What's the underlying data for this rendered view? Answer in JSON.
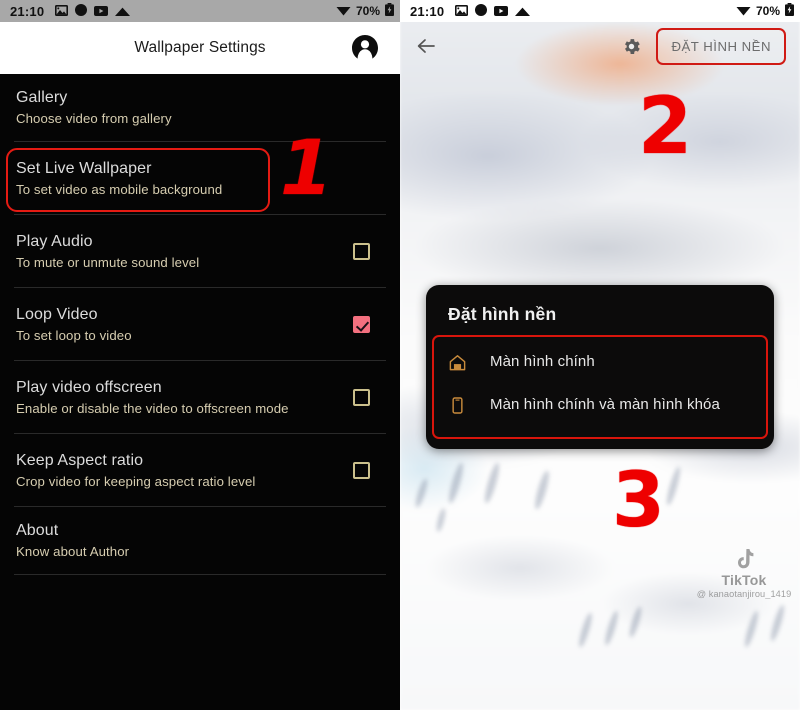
{
  "status_bar": {
    "time": "21:10",
    "battery_percent": "70%",
    "left_icons": [
      "image-icon",
      "record-circle-icon",
      "youtube-icon",
      "cloud-icon"
    ],
    "right_icons": [
      "wifi-icon",
      "battery-icon"
    ]
  },
  "left_screen": {
    "app_bar": {
      "title": "Wallpaper Settings",
      "avatar_icon": "account-avatar-icon"
    },
    "settings_rows": [
      {
        "title": "Gallery",
        "subtitle": "Choose video from gallery",
        "control": "none"
      },
      {
        "title": "Set Live Wallpaper",
        "subtitle": "To set video as mobile background",
        "control": "none",
        "highlighted": true
      },
      {
        "title": "Play Audio",
        "subtitle": "To mute or unmute sound level",
        "control": "checkbox",
        "checked": false
      },
      {
        "title": "Loop Video",
        "subtitle": "To set loop to video",
        "control": "checkbox",
        "checked": true
      },
      {
        "title": "Play video offscreen",
        "subtitle": "Enable or disable the video to offscreen mode",
        "control": "checkbox",
        "checked": false
      },
      {
        "title": "Keep Aspect ratio",
        "subtitle": "Crop video for keeping aspect ratio level",
        "control": "checkbox",
        "checked": false
      },
      {
        "title": "About",
        "subtitle": "Know about Author",
        "control": "none"
      }
    ],
    "annotation": "1"
  },
  "right_screen": {
    "toolbar": {
      "back_icon": "back-arrow-icon",
      "settings_icon": "gear-icon",
      "set_wallpaper_label": "ĐẶT HÌNH NỀN"
    },
    "dialog": {
      "title": "Đặt hình nền",
      "options": [
        {
          "label": "Màn hình chính",
          "icon": "home-icon"
        },
        {
          "label": "Màn hình chính và màn hình khóa",
          "icon": "phone-icon"
        }
      ]
    },
    "watermark": {
      "brand": "TikTok",
      "username": "@ kanaotanjirou_1419"
    },
    "annotations": [
      "2",
      "3"
    ]
  },
  "colors": {
    "annotation_red": "#ee0000",
    "highlight_border": "#e51b13",
    "checkbox_checked": "#f4707f",
    "checkbox_outline": "#cbc08c",
    "subtitle_text": "#d6cdb0",
    "dialog_icon": "#c98b3c"
  }
}
